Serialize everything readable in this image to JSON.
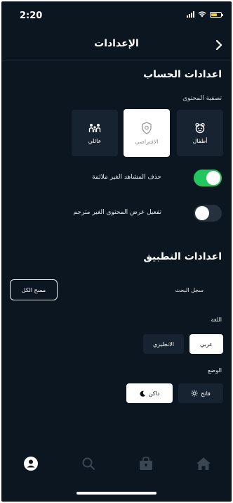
{
  "status_bar": {
    "time": "2:20"
  },
  "header": {
    "title": "الإعدادات"
  },
  "account_settings": {
    "title": "اعدادات الحساب",
    "content_filter_label": "تصفية المحتوى",
    "filters": [
      {
        "label": "أطفال",
        "icon": "child-face-icon"
      },
      {
        "label": "الافتراضي",
        "icon": "shield-icon",
        "selected": true
      },
      {
        "label": "عائلي",
        "icon": "family-icon"
      }
    ],
    "toggles": [
      {
        "label": "حذف المشاهد الغير ملائمة",
        "state": "on"
      },
      {
        "label": "تفعيل عرض المحتوى الغير مترجم",
        "state": "off"
      }
    ]
  },
  "app_settings": {
    "title": "اعدادات التطبيق",
    "history_label": "سجل البحث",
    "clear_button": "مسح الكل",
    "language_label": "اللغة",
    "languages": [
      {
        "label": "عربي",
        "selected": true
      },
      {
        "label": "الانجليزي",
        "selected": false
      }
    ],
    "theme_label": "الوضع",
    "themes": [
      {
        "label": "فاتح",
        "icon": "sun-icon",
        "selected": false
      },
      {
        "label": "داكن",
        "icon": "moon-icon",
        "selected": true
      }
    ]
  },
  "tab_bar": {
    "items": [
      "profile-icon",
      "search-icon",
      "downloads-icon",
      "home-icon"
    ],
    "active": "profile-icon"
  },
  "colors": {
    "background": "#0b1620",
    "card": "#172330",
    "accent": "#22c55e"
  }
}
